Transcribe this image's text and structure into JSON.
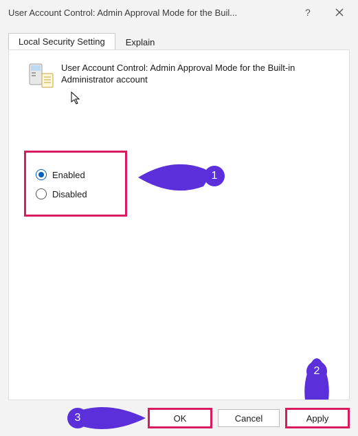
{
  "window": {
    "title": "User Account Control: Admin Approval Mode for the Buil..."
  },
  "tabs": {
    "setting": "Local Security Setting",
    "explain": "Explain"
  },
  "policy": {
    "title": "User Account Control: Admin Approval Mode for the Built-in Administrator account"
  },
  "radios": {
    "enabled": "Enabled",
    "disabled": "Disabled",
    "selected": "enabled"
  },
  "buttons": {
    "ok": "OK",
    "cancel": "Cancel",
    "apply": "Apply"
  },
  "annotations": {
    "n1": "1",
    "n2": "2",
    "n3": "3"
  }
}
